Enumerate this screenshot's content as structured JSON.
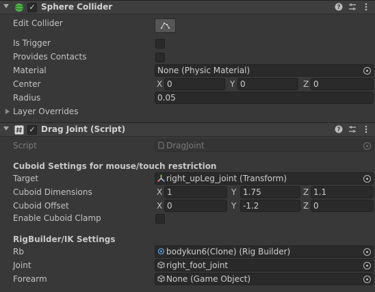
{
  "sphere_collider": {
    "title": "Sphere Collider",
    "enabled": true,
    "edit_collider_label": "Edit Collider",
    "is_trigger_label": "Is Trigger",
    "is_trigger": false,
    "provides_contacts_label": "Provides Contacts",
    "provides_contacts": false,
    "material_label": "Material",
    "material_value": "None (Physic Material)",
    "center_label": "Center",
    "center": {
      "x_label": "X",
      "x": "0",
      "y_label": "Y",
      "y": "0",
      "z_label": "Z",
      "z": "0"
    },
    "radius_label": "Radius",
    "radius": "0.05",
    "layer_overrides_label": "Layer Overrides"
  },
  "drag_joint": {
    "title": "Drag Joint (Script)",
    "enabled": true,
    "script_label": "Script",
    "script_value": "DragJoint",
    "cuboid_section_title": "Cuboid Settings for mouse/touch restriction",
    "target_label": "Target",
    "target_value": "right_upLeg_joint (Transform)",
    "cuboid_dimensions_label": "Cuboid Dimensions",
    "cuboid_dimensions": {
      "x_label": "X",
      "x": "1",
      "y_label": "Y",
      "y": "1.75",
      "z_label": "Z",
      "z": "1.1"
    },
    "cuboid_offset_label": "Cuboid Offset",
    "cuboid_offset": {
      "x_label": "X",
      "x": "0",
      "y_label": "Y",
      "y": "-1.2",
      "z_label": "Z",
      "z": "0"
    },
    "enable_cuboid_clamp_label": "Enable Cuboid Clamp",
    "enable_cuboid_clamp": false,
    "rig_section_title": "RigBuilder/IK Settings",
    "rb_label": "Rb",
    "rb_value": "bodykun6(Clone) (Rig Builder)",
    "joint_label": "Joint",
    "joint_value": "right_foot_joint",
    "forearm_label": "Forearm",
    "forearm_value": "None (Game Object)"
  },
  "icons": {
    "help": "help-icon",
    "presets": "presets-icon",
    "menu": "kebab-menu-icon",
    "collider": "sphere-collider-icon",
    "script": "script-hash-icon",
    "transform": "transform-icon",
    "object": "gameobject-cube-icon",
    "picker": "object-picker-icon"
  },
  "colors": {
    "panel_bg": "#383838",
    "header_bg": "#3e3e3e",
    "field_bg": "#2a2a2a",
    "collider_icon": "#4cb648"
  }
}
